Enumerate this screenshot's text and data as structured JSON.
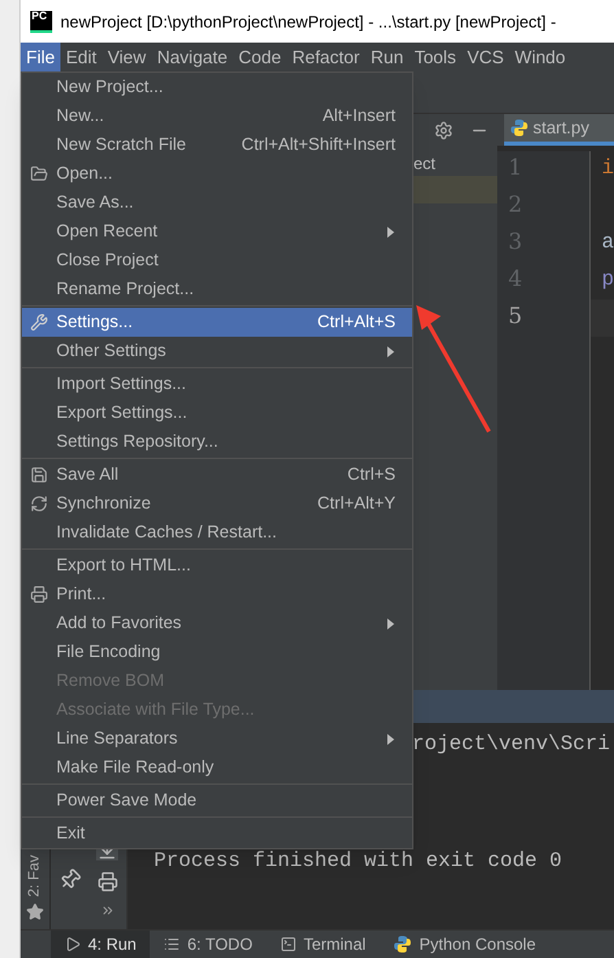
{
  "window": {
    "logo_text": "PC",
    "title": "newProject [D:\\pythonProject\\newProject] - ...\\start.py [newProject] -"
  },
  "menubar": [
    {
      "label": "File",
      "selected": true
    },
    {
      "label": "Edit",
      "selected": false
    },
    {
      "label": "View",
      "selected": false
    },
    {
      "label": "Navigate",
      "selected": false
    },
    {
      "label": "Code",
      "selected": false
    },
    {
      "label": "Refactor",
      "selected": false
    },
    {
      "label": "Run",
      "selected": false
    },
    {
      "label": "Tools",
      "selected": false
    },
    {
      "label": "VCS",
      "selected": false
    },
    {
      "label": "Windo",
      "selected": false
    }
  ],
  "file_menu": {
    "groups": [
      [
        {
          "label": "New Project...",
          "selected": false,
          "disabled": false,
          "submenu": false
        },
        {
          "label": "New...",
          "shortcut": "Alt+Insert",
          "selected": false,
          "disabled": false,
          "submenu": false
        },
        {
          "label": "New Scratch File",
          "shortcut": "Ctrl+Alt+Shift+Insert",
          "selected": false,
          "disabled": false,
          "submenu": false
        },
        {
          "label": "Open...",
          "selected": false,
          "disabled": false,
          "submenu": false
        },
        {
          "label": "Save As...",
          "selected": false,
          "disabled": false,
          "submenu": false
        },
        {
          "label": "Open Recent",
          "selected": false,
          "disabled": false,
          "submenu": true
        },
        {
          "label": "Close Project",
          "selected": false,
          "disabled": false,
          "submenu": false
        },
        {
          "label": "Rename Project...",
          "selected": false,
          "disabled": false,
          "submenu": false
        }
      ],
      [
        {
          "label": "Settings...",
          "shortcut": "Ctrl+Alt+S",
          "selected": true,
          "disabled": false,
          "submenu": false
        },
        {
          "label": "Other Settings",
          "selected": false,
          "disabled": false,
          "submenu": true
        }
      ],
      [
        {
          "label": "Import Settings...",
          "selected": false,
          "disabled": false,
          "submenu": false
        },
        {
          "label": "Export Settings...",
          "selected": false,
          "disabled": false,
          "submenu": false
        },
        {
          "label": "Settings Repository...",
          "selected": false,
          "disabled": false,
          "submenu": false
        }
      ],
      [
        {
          "label": "Save All",
          "shortcut": "Ctrl+S",
          "selected": false,
          "disabled": false,
          "submenu": false
        },
        {
          "label": "Synchronize",
          "shortcut": "Ctrl+Alt+Y",
          "selected": false,
          "disabled": false,
          "submenu": false
        },
        {
          "label": "Invalidate Caches / Restart...",
          "selected": false,
          "disabled": false,
          "submenu": false
        }
      ],
      [
        {
          "label": "Export to HTML...",
          "selected": false,
          "disabled": false,
          "submenu": false
        },
        {
          "label": "Print...",
          "selected": false,
          "disabled": false,
          "submenu": false
        },
        {
          "label": "Add to Favorites",
          "selected": false,
          "disabled": false,
          "submenu": true
        },
        {
          "label": "File Encoding",
          "selected": false,
          "disabled": false,
          "submenu": false
        },
        {
          "label": "Remove BOM",
          "selected": false,
          "disabled": true,
          "submenu": false
        },
        {
          "label": "Associate with File Type...",
          "selected": false,
          "disabled": true,
          "submenu": false
        },
        {
          "label": "Line Separators",
          "selected": false,
          "disabled": false,
          "submenu": true
        },
        {
          "label": "Make File Read-only",
          "selected": false,
          "disabled": false,
          "submenu": false
        }
      ],
      [
        {
          "label": "Power Save Mode",
          "selected": false,
          "disabled": false,
          "submenu": false
        }
      ],
      [
        {
          "label": "Exit",
          "selected": false,
          "disabled": false,
          "submenu": false
        }
      ]
    ]
  },
  "project_panel": {
    "tree_text": "ect"
  },
  "editor": {
    "tab": "start.py",
    "lines": [
      {
        "number": "1",
        "text": "i",
        "kind": "keyword",
        "current": false
      },
      {
        "number": "2",
        "current": false
      },
      {
        "number": "3",
        "text": "a",
        "kind": "plain",
        "current": false
      },
      {
        "number": "4",
        "text": "p",
        "kind": "builtin",
        "current": false
      },
      {
        "number": "5",
        "current": true
      }
    ]
  },
  "run_panel": {
    "command": "roject\\venv\\Scri",
    "output": "Process finished with exit code 0"
  },
  "left_strip": {
    "favorites": "2: Fav"
  },
  "bottom_tabs": [
    {
      "label": "4: Run",
      "selected": true
    },
    {
      "label": "6: TODO",
      "selected": false
    },
    {
      "label": "Terminal",
      "selected": false
    },
    {
      "label": "Python Console",
      "selected": false
    }
  ]
}
